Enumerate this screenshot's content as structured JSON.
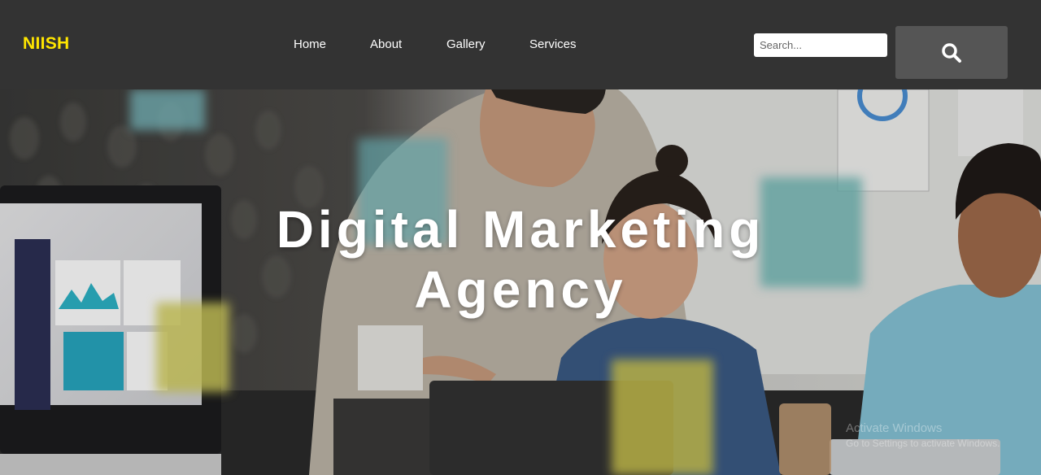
{
  "brand": {
    "name": "NIISH",
    "color": "#ffe600"
  },
  "nav": {
    "items": [
      {
        "label": "Home"
      },
      {
        "label": "About"
      },
      {
        "label": "Gallery"
      },
      {
        "label": "Services"
      }
    ]
  },
  "search": {
    "placeholder": "Search...",
    "value": "",
    "icon": "search-icon"
  },
  "hero": {
    "title_line1": "Digital Marketing",
    "title_line2": "Agency"
  },
  "watermark": {
    "line1": "Activate Windows",
    "line2": "Go to Settings to activate Windows."
  },
  "colors": {
    "navbar": "#333333",
    "search_button": "#555555",
    "brand": "#ffe600"
  }
}
